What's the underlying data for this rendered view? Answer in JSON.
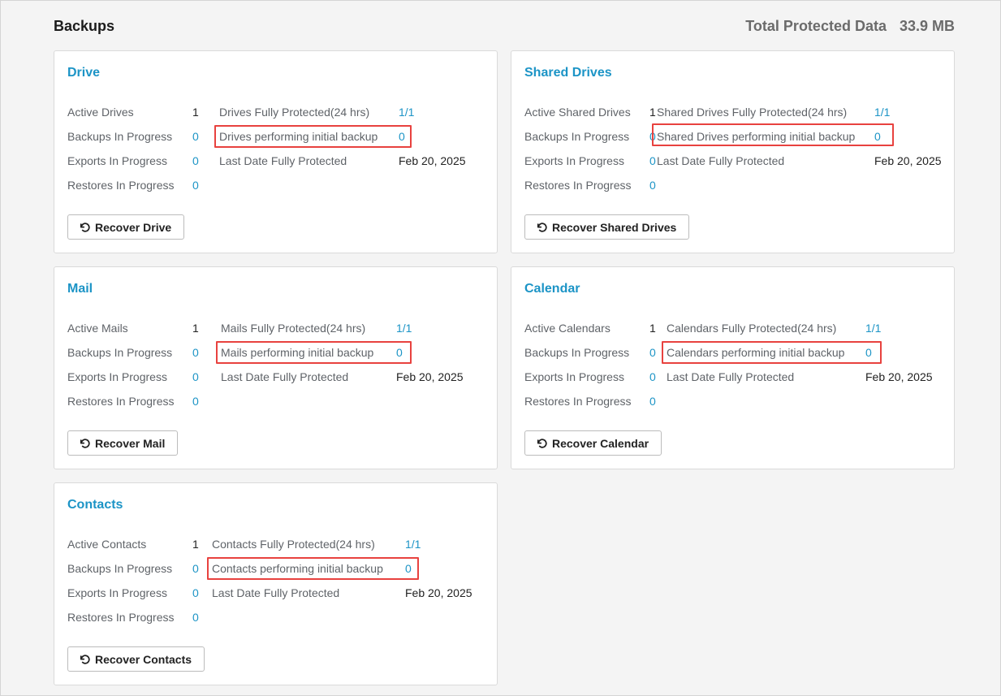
{
  "header": {
    "title": "Backups",
    "total_label": "Total Protected Data",
    "total_value": "33.9 MB"
  },
  "cards": {
    "drive": {
      "title": "Drive",
      "active_label": "Active Drives",
      "active_value": "1",
      "backups_label": "Backups In Progress",
      "backups_value": "0",
      "exports_label": "Exports In Progress",
      "exports_value": "0",
      "restores_label": "Restores In Progress",
      "restores_value": "0",
      "fully_label": "Drives Fully Protected(24 hrs)",
      "fully_value": "1/1",
      "initial_label": "Drives performing initial backup",
      "initial_value": "0",
      "last_label": "Last Date Fully Protected",
      "last_value": "Feb 20, 2025",
      "button": "Recover Drive"
    },
    "shared": {
      "title": "Shared Drives",
      "active_label": "Active Shared Drives",
      "active_value": "1",
      "backups_label": "Backups In Progress",
      "backups_value": "0",
      "exports_label": "Exports In Progress",
      "exports_value": "0",
      "restores_label": "Restores In Progress",
      "restores_value": "0",
      "fully_label": "Shared Drives Fully Protected(24 hrs)",
      "fully_value": "1/1",
      "initial_label": "Shared Drives performing initial backup",
      "initial_value": "0",
      "last_label": "Last Date Fully Protected",
      "last_value": "Feb 20, 2025",
      "button": "Recover Shared Drives"
    },
    "mail": {
      "title": "Mail",
      "active_label": "Active Mails",
      "active_value": "1",
      "backups_label": "Backups In Progress",
      "backups_value": "0",
      "exports_label": "Exports In Progress",
      "exports_value": "0",
      "restores_label": "Restores In Progress",
      "restores_value": "0",
      "fully_label": "Mails Fully Protected(24 hrs)",
      "fully_value": "1/1",
      "initial_label": "Mails performing initial backup",
      "initial_value": "0",
      "last_label": "Last Date Fully Protected",
      "last_value": "Feb 20, 2025",
      "button": "Recover Mail"
    },
    "calendar": {
      "title": "Calendar",
      "active_label": "Active Calendars",
      "active_value": "1",
      "backups_label": "Backups In Progress",
      "backups_value": "0",
      "exports_label": "Exports In Progress",
      "exports_value": "0",
      "restores_label": "Restores In Progress",
      "restores_value": "0",
      "fully_label": "Calendars Fully Protected(24 hrs)",
      "fully_value": "1/1",
      "initial_label": "Calendars performing initial backup",
      "initial_value": "0",
      "last_label": "Last Date Fully Protected",
      "last_value": "Feb 20, 2025",
      "button": "Recover Calendar"
    },
    "contacts": {
      "title": "Contacts",
      "active_label": "Active Contacts",
      "active_value": "1",
      "backups_label": "Backups In Progress",
      "backups_value": "0",
      "exports_label": "Exports In Progress",
      "exports_value": "0",
      "restores_label": "Restores In Progress",
      "restores_value": "0",
      "fully_label": "Contacts Fully Protected(24 hrs)",
      "fully_value": "1/1",
      "initial_label": "Contacts performing initial backup",
      "initial_value": "0",
      "last_label": "Last Date Fully Protected",
      "last_value": "Feb 20, 2025",
      "button": "Recover Contacts"
    }
  },
  "colors": {
    "accent": "#1c94c6",
    "highlight": "#e8423f"
  },
  "icons": {
    "recover": "restore-icon"
  }
}
